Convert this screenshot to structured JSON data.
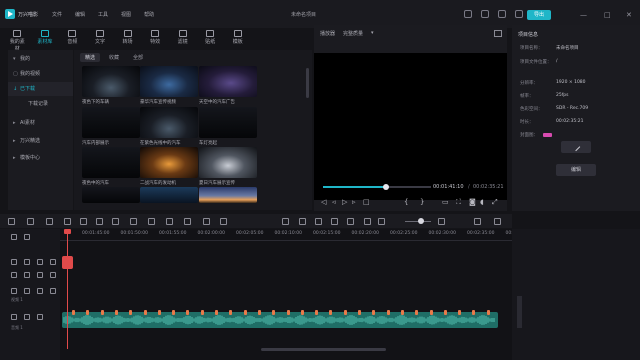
{
  "titlebar": {
    "app_name": "万兴喵影",
    "menu": [
      "文件",
      "编辑",
      "工具",
      "视图",
      "帮助"
    ],
    "project_title": "未命名项目",
    "export_label": "导出",
    "win_controls": [
      "—",
      "□",
      "✕"
    ]
  },
  "media_toolbar": [
    {
      "label": "我的素材",
      "icon": "folder-icon"
    },
    {
      "label": "素材库",
      "icon": "library-icon"
    },
    {
      "label": "音频",
      "icon": "music-icon"
    },
    {
      "label": "文字",
      "icon": "text-icon"
    },
    {
      "label": "转场",
      "icon": "transition-icon"
    },
    {
      "label": "特效",
      "icon": "effects-icon"
    },
    {
      "label": "滤镜",
      "icon": "filter-icon"
    },
    {
      "label": "贴纸",
      "icon": "sticker-icon"
    },
    {
      "label": "模板",
      "icon": "template-icon"
    }
  ],
  "sidebar": {
    "items": [
      "我的",
      "我的视频",
      "已下载",
      "下载记录",
      "AI素材",
      "万兴精选",
      "模板中心"
    ]
  },
  "media_panel": {
    "tabs": [
      "精选",
      "收藏",
      "全部"
    ],
    "thumbs": [
      {
        "label": "夜色下的车辆",
        "theme": "dark-car"
      },
      {
        "label": "豪华汽车宣传视频",
        "theme": "blue-car"
      },
      {
        "label": "天空中的汽车广告",
        "theme": "purple-car"
      },
      {
        "label": "汽车内部展示",
        "theme": "dark"
      },
      {
        "label": "在紫色光线中的汽车",
        "theme": "dark-car"
      },
      {
        "label": "车灯亮起",
        "theme": "dark"
      },
      {
        "label": "夜色中的汽车",
        "theme": "dark"
      },
      {
        "label": "二战汽车的发动机",
        "theme": "orange-car"
      },
      {
        "label": "夏日汽车展示宣传",
        "theme": "silver-car"
      },
      {
        "label": "",
        "theme": "dark"
      },
      {
        "label": "",
        "theme": "blue"
      },
      {
        "label": "",
        "theme": "sunset"
      }
    ]
  },
  "player": {
    "tabs": [
      "播放器",
      "完整质量"
    ],
    "progress_fraction": 0.58,
    "time_current": "00:01:41:10",
    "time_separator": "/",
    "time_total": "00:02:35:21"
  },
  "properties": {
    "tab_label": "项目信息",
    "rows": [
      {
        "key": "项目名称：",
        "value": "未命名项目"
      },
      {
        "key": "项目文件位置：",
        "value": "/"
      },
      {
        "key": "分辨率：",
        "value": "1920 × 1080"
      },
      {
        "key": "帧率：",
        "value": "25fps"
      },
      {
        "key": "色彩空间：",
        "value": "SDR - Rec.709"
      },
      {
        "key": "时长：",
        "value": "00:02:35:21"
      },
      {
        "key": "封面图：",
        "value": ""
      }
    ],
    "save_label": "编辑"
  },
  "timeline": {
    "ticks": [
      "00:01:45:00",
      "00:01:50:00",
      "00:01:55:00",
      "00:02:00:00",
      "00:02:05:00",
      "00:02:10:00",
      "00:02:15:00",
      "00:02:20:00",
      "00:02:25:00",
      "00:02:30:00",
      "00:02:35:00",
      "00:02:4"
    ],
    "track_labels": [
      "视频 1",
      "音频 1"
    ]
  },
  "colors": {
    "accent": "#1fb6c8",
    "playhead": "#e04a4a",
    "audio_clip": "#1f6e66",
    "marker": "#e87a4a"
  }
}
